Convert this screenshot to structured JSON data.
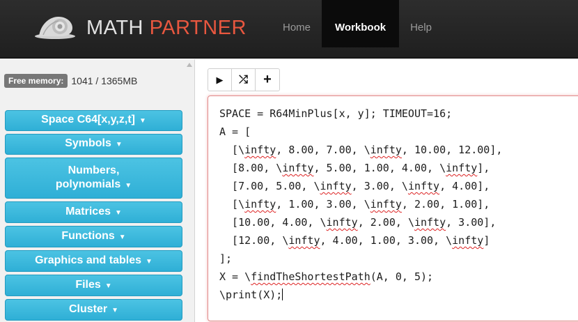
{
  "header": {
    "brand_part1": "MATH ",
    "brand_part2": "PARTNER",
    "brand_colors": {
      "primary": "#e2e2e2",
      "accent": "#e8573f"
    },
    "nav": [
      {
        "label": "Home",
        "active": false
      },
      {
        "label": "Workbook",
        "active": true
      },
      {
        "label": "Help",
        "active": false
      }
    ]
  },
  "sidebar": {
    "memory_label": "Free memory:",
    "memory_value": "1041 / 1365MB",
    "menu": [
      {
        "label": "Space C64[x,y,z,t]"
      },
      {
        "label": "Symbols"
      },
      {
        "label_line1": "Numbers,",
        "label_line2": "polynomials"
      },
      {
        "label": "Matrices"
      },
      {
        "label": "Functions"
      },
      {
        "label": "Graphics and tables"
      },
      {
        "label": "Files"
      },
      {
        "label": "Cluster"
      }
    ],
    "caret": "▼"
  },
  "toolbar": {
    "run_icon": "▶",
    "shuffle_icon": "⤮",
    "add_icon": "+"
  },
  "editor": {
    "lines": [
      "SPACE = R64MinPlus[x, y]; TIMEOUT=16;",
      "A = [",
      "  [\\infty, 8.00, 7.00, \\infty, 10.00, 12.00],",
      "  [8.00, \\infty, 5.00, 1.00, 4.00, \\infty],",
      "  [7.00, 5.00, \\infty, 3.00, \\infty, 4.00],",
      "  [\\infty, 1.00, 3.00, \\infty, 2.00, 1.00],",
      "  [10.00, 4.00, \\infty, 2.00, \\infty, 3.00],",
      "  [12.00, \\infty, 4.00, 1.00, 3.00, \\infty]",
      "];",
      "X = \\findTheShortestPath(A, 0, 5);",
      "\\print(X);"
    ]
  },
  "colors": {
    "menu_button": "#36b4da",
    "header_bg": "#262626",
    "editor_border": "#e08c8c"
  }
}
